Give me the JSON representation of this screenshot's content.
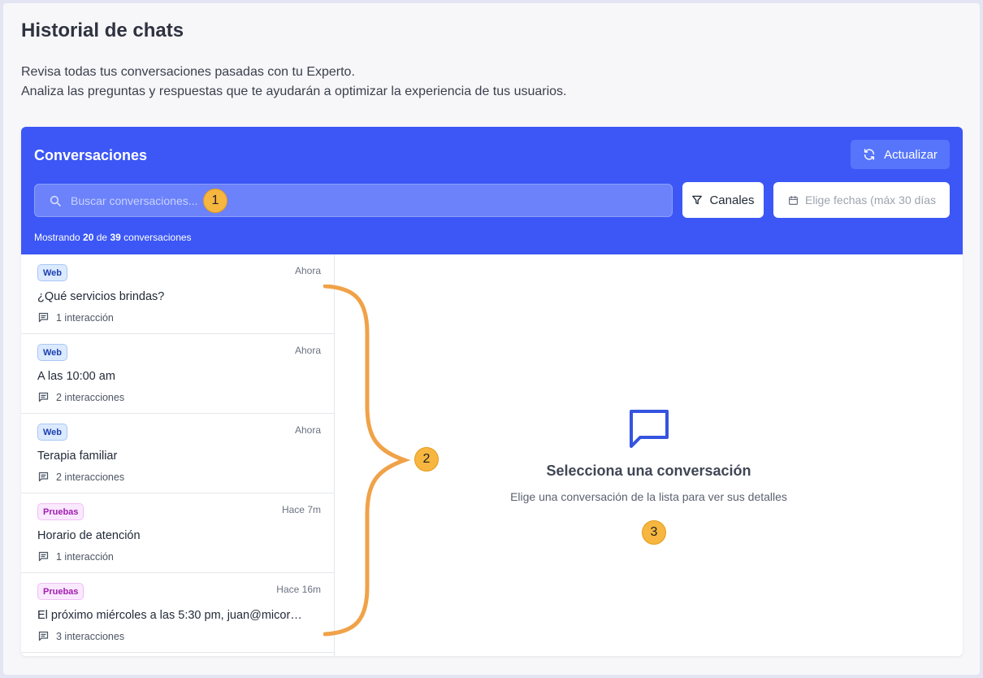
{
  "page": {
    "title": "Historial de chats",
    "description_line1": "Revisa todas tus conversaciones pasadas con tu Experto.",
    "description_line2": "Analiza las preguntas y respuestas que te ayudarán a optimizar la experiencia de tus usuarios."
  },
  "panel": {
    "title": "Conversaciones",
    "refresh_label": "Actualizar",
    "search_placeholder": "Buscar conversaciones...",
    "channels_label": "Canales",
    "date_placeholder": "Elige fechas (máx 30 días",
    "count": {
      "prefix": "Mostrando",
      "shown": "20",
      "of": "de",
      "total": "39",
      "suffix": "conversaciones"
    }
  },
  "conversations": [
    {
      "channel": "Web",
      "time": "Ahora",
      "message": "¿Qué servicios brindas?",
      "interactions": "1 interacción"
    },
    {
      "channel": "Web",
      "time": "Ahora",
      "message": "A las 10:00 am",
      "interactions": "2 interacciones"
    },
    {
      "channel": "Web",
      "time": "Ahora",
      "message": "Terapia familiar",
      "interactions": "2 interacciones"
    },
    {
      "channel": "Pruebas",
      "time": "Hace 7m",
      "message": "Horario de atención",
      "interactions": "1 interacción"
    },
    {
      "channel": "Pruebas",
      "time": "Hace 16m",
      "message": "El próximo miércoles a las 5:30 pm, juan@micorreo....",
      "interactions": "3 interacciones"
    }
  ],
  "detail": {
    "empty_title": "Selecciona una conversación",
    "empty_subtitle": "Elige una conversación de la lista para ver sus detalles"
  },
  "annotations": {
    "marker1": "1",
    "marker2": "2",
    "marker3": "3"
  },
  "icons": {
    "refresh": "refresh-icon",
    "search": "search-icon",
    "filter": "filter-icon",
    "calendar": "calendar-icon",
    "message": "message-icon",
    "chat": "chat-bubble-icon"
  },
  "colors": {
    "header_bg": "#3c57f6",
    "web_badge_bg": "#dbeafe",
    "pruebas_badge_bg": "#fae8ff",
    "annotation_marker": "#f6b640",
    "annotation_brace": "#f0a248",
    "empty_state_icon": "#3554e0"
  }
}
